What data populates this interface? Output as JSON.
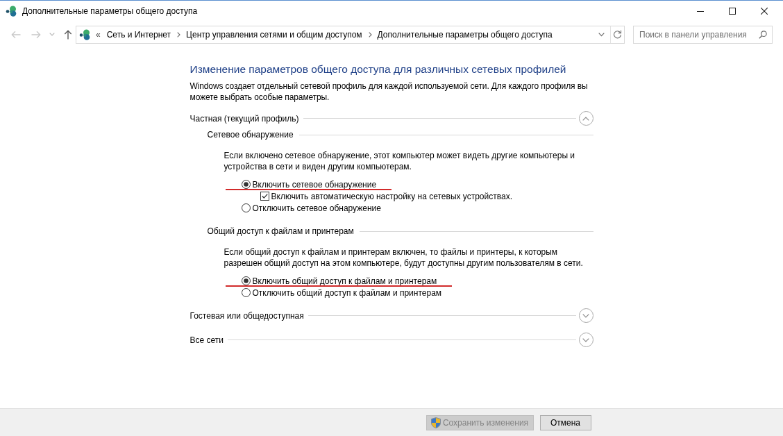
{
  "window": {
    "title": "Дополнительные параметры общего доступа"
  },
  "navigation": {
    "back": {
      "disabled": true
    },
    "forward": {
      "disabled": true
    },
    "up": {
      "disabled": false
    }
  },
  "address_bar": {
    "overflow": "«",
    "breadcrumbs": [
      "Сеть и Интернет",
      "Центр управления сетями и общим доступом",
      "Дополнительные параметры общего доступа"
    ]
  },
  "search": {
    "placeholder": "Поиск в панели управления"
  },
  "heading": "Изменение параметров общего доступа для различных сетевых профилей",
  "description": "Windows создает отдельный сетевой профиль для каждой используемой сети. Для каждого профиля вы можете выбрать особые параметры.",
  "profiles": [
    {
      "label": "Частная (текущий профиль)",
      "expanded": true,
      "sections": [
        {
          "label": "Сетевое обнаружение",
          "description": "Если включено сетевое обнаружение, этот компьютер может видеть другие компьютеры и устройства в сети и виден другим компьютерам.",
          "options": [
            {
              "kind": "radio",
              "label": "Включить сетевое обнаружение",
              "selected": true,
              "underlined": true,
              "children": [
                {
                  "kind": "checkbox",
                  "label": "Включить автоматическую настройку на сетевых устройствах.",
                  "checked": true
                }
              ]
            },
            {
              "kind": "radio",
              "label": "Отключить сетевое обнаружение",
              "selected": false,
              "underlined": false
            }
          ]
        },
        {
          "label": "Общий доступ к файлам и принтерам",
          "description": "Если общий доступ к файлам и принтерам включен, то файлы и принтеры, к которым разрешен общий доступ на этом компьютере, будут доступны другим пользователям в сети.",
          "options": [
            {
              "kind": "radio",
              "label": "Включить общий доступ к файлам и принтерам",
              "selected": true,
              "underlined": true
            },
            {
              "kind": "radio",
              "label": "Отключить общий доступ к файлам и принтерам",
              "selected": false,
              "underlined": false
            }
          ]
        }
      ]
    },
    {
      "label": "Гостевая или общедоступная",
      "expanded": false
    },
    {
      "label": "Все сети",
      "expanded": false
    }
  ],
  "buttons": [
    {
      "label": "Сохранить изменения",
      "disabled": true,
      "shield": true
    },
    {
      "label": "Отмена",
      "disabled": false,
      "shield": false
    }
  ]
}
